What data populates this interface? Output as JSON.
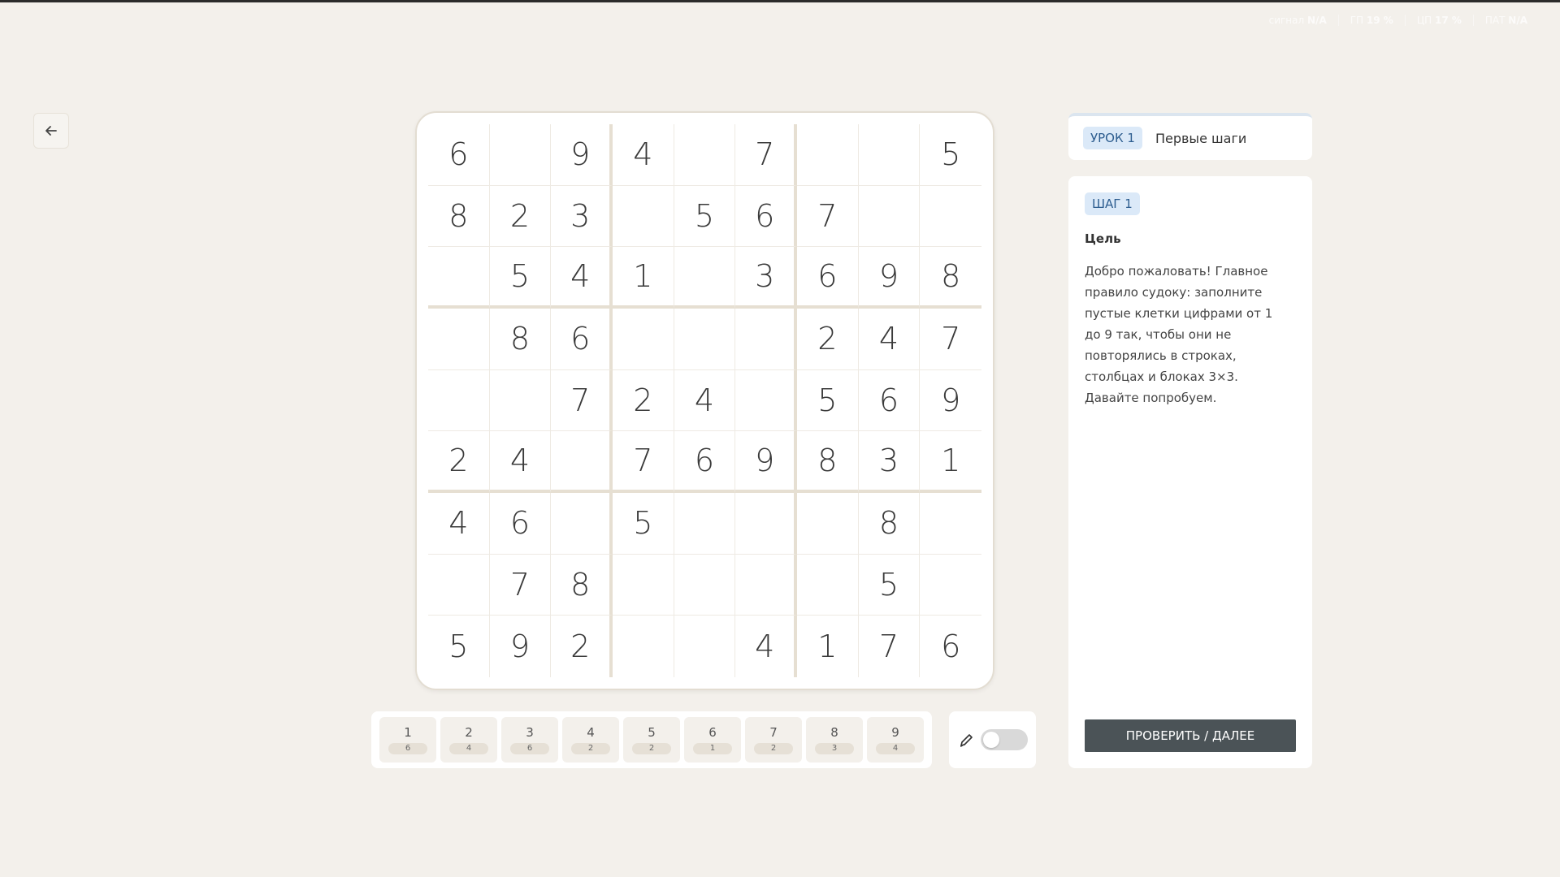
{
  "stats": [
    {
      "label": "сигнал",
      "value": "N/A"
    },
    {
      "label": "ГП",
      "value": "19 %"
    },
    {
      "label": "ЦП",
      "value": "17 %"
    },
    {
      "label": "ПАТ",
      "value": "N/A"
    }
  ],
  "board": [
    [
      "6",
      "",
      "9",
      "4",
      "",
      "7",
      "",
      "",
      "5"
    ],
    [
      "8",
      "2",
      "3",
      "",
      "5",
      "6",
      "7",
      "",
      ""
    ],
    [
      "",
      "5",
      "4",
      "1",
      "",
      "3",
      "6",
      "9",
      "8"
    ],
    [
      "",
      "8",
      "6",
      "",
      "",
      "",
      "2",
      "4",
      "7"
    ],
    [
      "",
      "",
      "7",
      "2",
      "4",
      "",
      "5",
      "6",
      "9"
    ],
    [
      "2",
      "4",
      "",
      "7",
      "6",
      "9",
      "8",
      "3",
      "1"
    ],
    [
      "4",
      "6",
      "",
      "5",
      "",
      "",
      "",
      "8",
      ""
    ],
    [
      "",
      "7",
      "8",
      "",
      "",
      "",
      "",
      "5",
      ""
    ],
    [
      "5",
      "9",
      "2",
      "",
      "",
      "4",
      "1",
      "7",
      "6"
    ]
  ],
  "numpad": [
    {
      "digit": "1",
      "count": "6"
    },
    {
      "digit": "2",
      "count": "4"
    },
    {
      "digit": "3",
      "count": "6"
    },
    {
      "digit": "4",
      "count": "2"
    },
    {
      "digit": "5",
      "count": "2"
    },
    {
      "digit": "6",
      "count": "1"
    },
    {
      "digit": "7",
      "count": "2"
    },
    {
      "digit": "8",
      "count": "3"
    },
    {
      "digit": "9",
      "count": "4"
    }
  ],
  "pencil_mode": false,
  "lesson": {
    "badge": "УРОК 1",
    "title": "Первые шаги"
  },
  "step": {
    "badge": "ШАГ 1",
    "goal_title": "Цель",
    "goal_text": "Добро пожаловать! Главное правило судоку: заполните пустые клетки цифрами от 1 до 9 так, чтобы они не повторялись в строках, столбцах и блоках 3×3. Давайте попробуем.",
    "button": "ПРОВЕРИТЬ / ДАЛЕЕ"
  },
  "icons": {
    "back": "arrow-left-icon",
    "pencil": "pencil-icon"
  }
}
